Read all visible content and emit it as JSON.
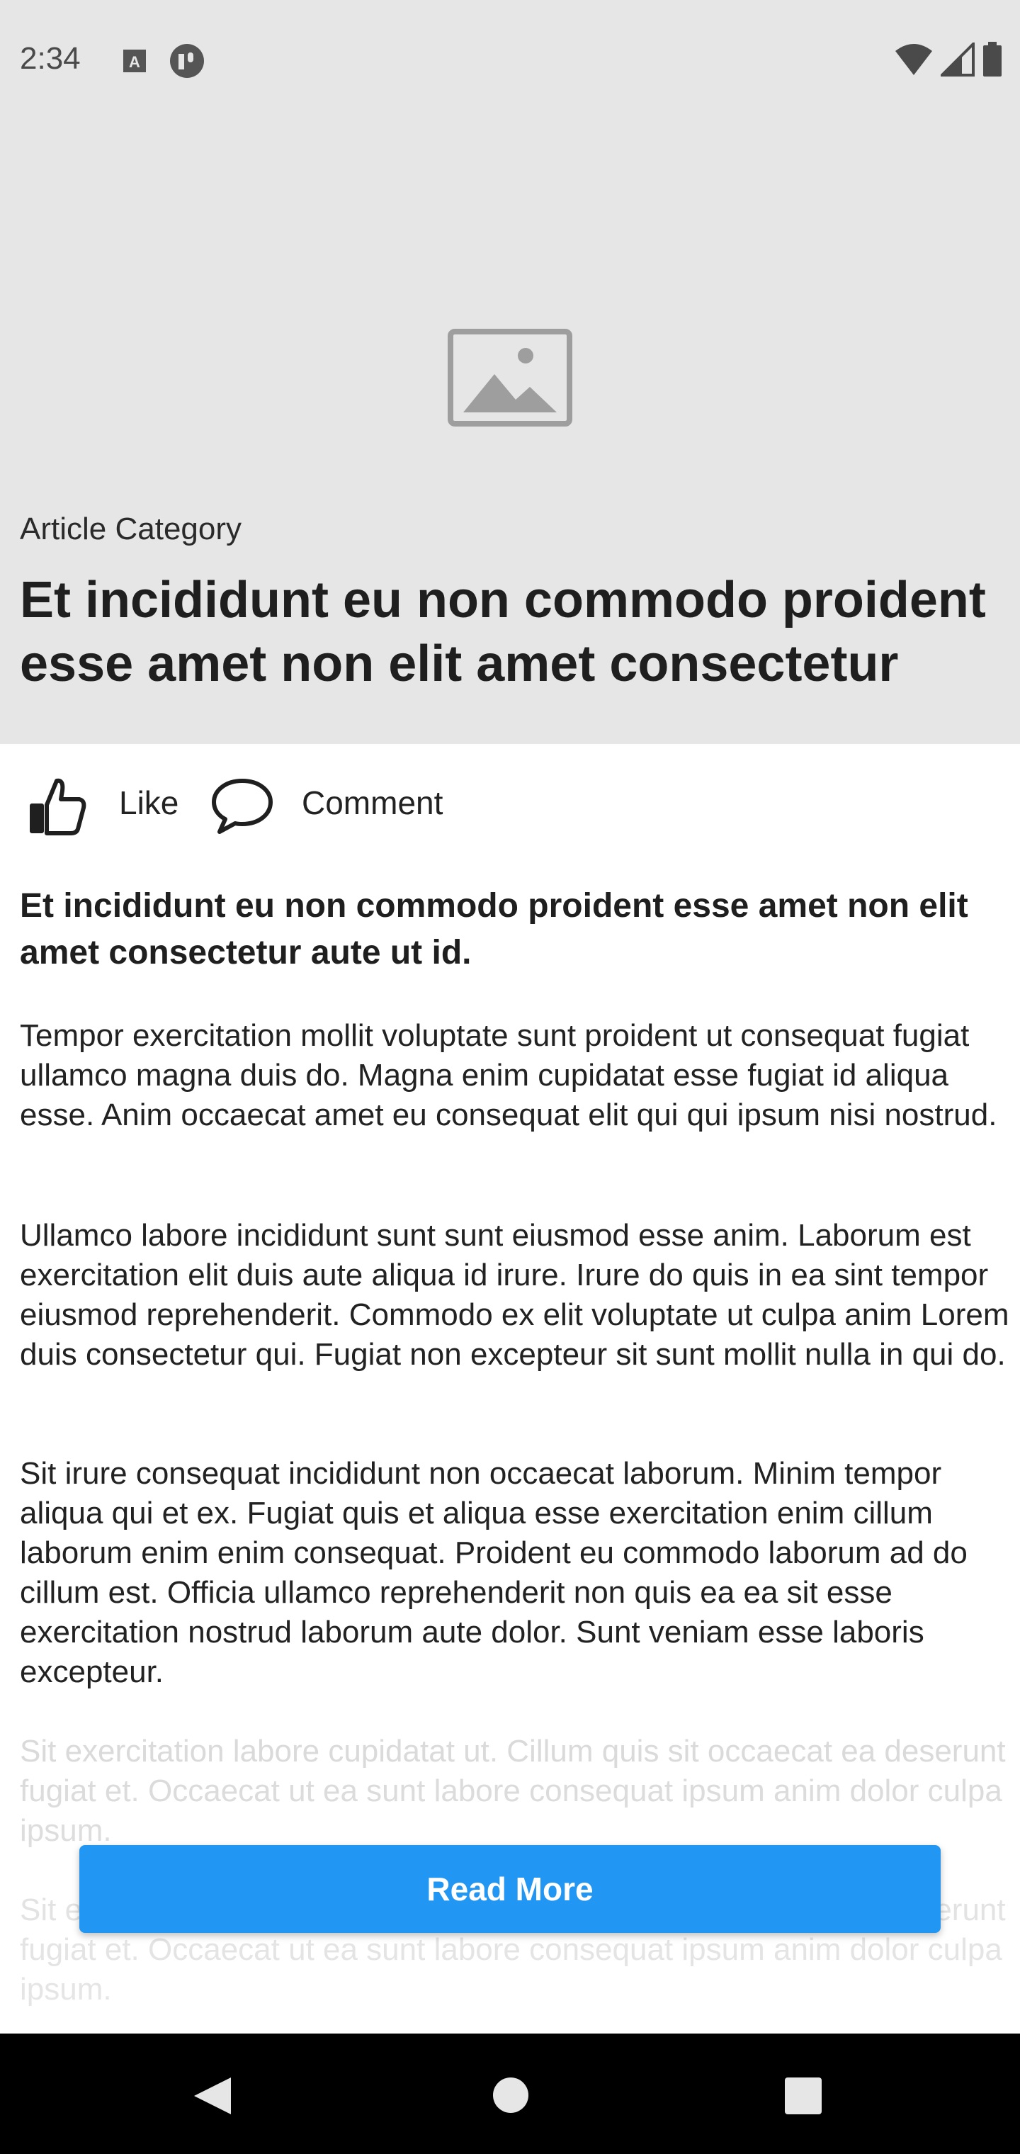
{
  "status_bar": {
    "time": "2:34",
    "left_icons": [
      "font-icon",
      "notification-app-icon"
    ],
    "right_icons": [
      "wifi-icon",
      "cell-signal-icon",
      "battery-icon"
    ]
  },
  "header": {
    "image_icon": "image-placeholder-icon",
    "category": "Article Category",
    "title": "Et incididunt eu non commodo proident esse amet non elit amet consectetur"
  },
  "actions": {
    "like_label": "Like",
    "comment_label": "Comment"
  },
  "article": {
    "lead": "Et incididunt eu non commodo proident esse amet non elit amet consectetur aute ut id.",
    "paragraphs": [
      "Tempor exercitation mollit voluptate sunt proident ut consequat fugiat ullamco magna duis do. Magna enim cupidatat esse fugiat id aliqua esse. Anim occaecat amet eu consequat elit qui qui ipsum nisi nostrud.",
      "Ullamco labore incididunt sunt sunt eiusmod esse anim. Laborum est exercitation elit duis aute aliqua id irure. Irure do quis in ea sint tempor eiusmod reprehenderit. Commodo ex elit voluptate ut culpa anim Lorem duis consectetur qui. Fugiat non excepteur sit sunt mollit nulla in qui do.",
      "Sit irure consequat incididunt non occaecat laborum. Minim tempor aliqua qui et ex. Fugiat quis et aliqua esse exercitation enim cillum laborum enim enim consequat. Proident eu commodo laborum ad do cillum est. Officia ullamco reprehenderit non quis ea ea sit esse exercitation nostrud laborum aute dolor. Sunt veniam esse laboris excepteur.",
      "Sit exercitation labore cupidatat ut. Cillum quis sit occaecat ea deserunt fugiat et. Occaecat ut ea sunt labore consequat ipsum anim dolor culpa ipsum.",
      "Sit exercitation labore cupidatat ut. Cillum quis sit occaecat ea deserunt fugiat et. Occaecat ut ea sunt labore consequat ipsum anim dolor culpa ipsum."
    ]
  },
  "read_more_label": "Read More",
  "colors": {
    "header_bg": "#e6e6e6",
    "accent": "#2196f3",
    "nav_bg": "#000000"
  },
  "nav_bar": {
    "icons": [
      "back-icon",
      "home-icon",
      "recents-icon"
    ]
  }
}
